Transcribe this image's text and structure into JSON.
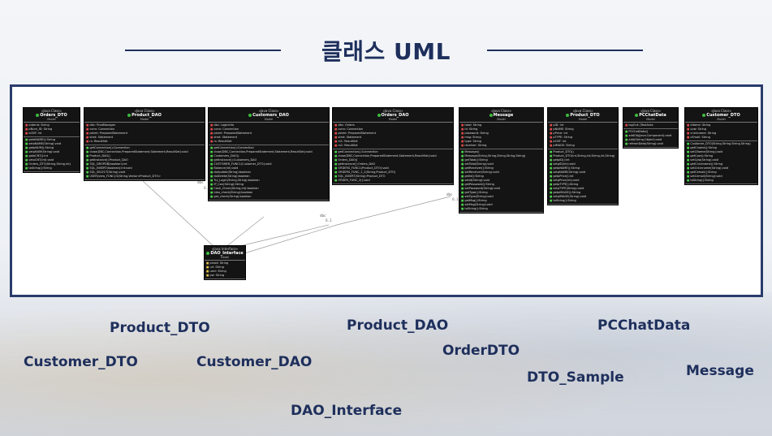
{
  "title": "클래스 UML",
  "diagram": {
    "classes": [
      {
        "id": "orders_dto",
        "stereotype": "«Java Class»",
        "name": "Orders_DTO",
        "package": "Model",
        "attrs": [
          {
            "m": "r",
            "t": "orderid: String"
          },
          {
            "m": "r",
            "t": "pNum_ID: String"
          },
          {
            "m": "r",
            "t": "oCNT: int"
          }
        ],
        "ops": [
          {
            "m": "g",
            "t": "getoNAME():String"
          },
          {
            "m": "g",
            "t": "setoNAME(String):void"
          },
          {
            "m": "g",
            "t": "getpNUM():String"
          },
          {
            "m": "g",
            "t": "setpNUM(String):void"
          },
          {
            "m": "g",
            "t": "getoCNT():int"
          },
          {
            "m": "g",
            "t": "setoCNT(int):void"
          },
          {
            "m": "g",
            "t": "Orders_DTO(String,String,int)"
          },
          {
            "m": "g",
            "t": "toString():String"
          }
        ]
      },
      {
        "id": "product_dao",
        "stereotype": "«Java Class»",
        "name": "Product_DAO",
        "package": "Model",
        "attrs": [
          {
            "m": "r",
            "t": "dbc: ProdManager"
          },
          {
            "m": "r",
            "t": "conn: Connection"
          },
          {
            "m": "r",
            "t": "pstmt: PreparedStatement"
          },
          {
            "m": "r",
            "t": "stmt: Statement"
          },
          {
            "m": "r",
            "t": "rs: ResultSet"
          }
        ],
        "ops": [
          {
            "m": "g",
            "t": "getConnection():Connection"
          },
          {
            "m": "g",
            "t": "close(DBC,Connection,PreparedStatement,Statement,ResultSet):void"
          },
          {
            "m": "g",
            "t": "Product_DAO()"
          },
          {
            "m": "g",
            "t": "getInstance():Product_DAO"
          },
          {
            "m": "g",
            "t": "SQL_DROPDB(boolean):int"
          },
          {
            "m": "g",
            "t": "SQL_INSERT(boolean):int:void"
          },
          {
            "m": "g",
            "t": "SQL_SELECT(String):void"
          },
          {
            "m": "g",
            "t": "USER(view_FUNC):S(String,Vector<Product_DTO>"
          }
        ]
      },
      {
        "id": "customer_dao",
        "stereotype": "«Java Class»",
        "name": "Customers_DAO",
        "package": "Model",
        "attrs": [
          {
            "m": "r",
            "t": "dbc: LoginInfo"
          },
          {
            "m": "r",
            "t": "conn: Connection"
          },
          {
            "m": "r",
            "t": "pstmt: PreparedStatement"
          },
          {
            "m": "r",
            "t": "stmt: Statement"
          },
          {
            "m": "r",
            "t": "rs: ResultSet"
          }
        ],
        "ops": [
          {
            "m": "g",
            "t": "getConnection():Connection"
          },
          {
            "m": "g",
            "t": "close(DBC,Connection,PreparedStatement,Statement,ResultSet):void"
          },
          {
            "m": "g",
            "t": "Customers_DAO()"
          },
          {
            "m": "g",
            "t": "getInstance():Customers_DAO"
          },
          {
            "m": "g",
            "t": "CUSTOMER_FUNC1(Customer_DTO):void"
          },
          {
            "m": "g",
            "t": "Balance(int):void"
          },
          {
            "m": "g",
            "t": "doUpdate(String):boolean"
          },
          {
            "m": "g",
            "t": "doDelete(String):boolean"
          },
          {
            "m": "g",
            "t": "Try_Login(String,String):boolean"
          },
          {
            "m": "g",
            "t": "IP_Con(String):String"
          },
          {
            "m": "g",
            "t": "Cash_Check(String,int):boolean"
          },
          {
            "m": "g",
            "t": "ideo_check(String):boolean"
          },
          {
            "m": "g",
            "t": "get_check(String):boolean"
          }
        ]
      },
      {
        "id": "orders_dao",
        "stereotype": "«Java Class»",
        "name": "Orders_DAO",
        "package": "Model",
        "attrs": [
          {
            "m": "r",
            "t": "dbc: Orders"
          },
          {
            "m": "r",
            "t": "conn: Connection"
          },
          {
            "m": "r",
            "t": "pstmt: PreparedStatement"
          },
          {
            "m": "r",
            "t": "stmt: Statement"
          },
          {
            "m": "r",
            "t": "rs1: ResultSet"
          },
          {
            "m": "r",
            "t": "rs2: ResultSet"
          }
        ],
        "ops": [
          {
            "m": "g",
            "t": "getConnection():Connection"
          },
          {
            "m": "g",
            "t": "close(DBC,Connection,PreparedStatement,Statement,ResultSet):void"
          },
          {
            "m": "g",
            "t": "Orders_DAO()"
          },
          {
            "m": "g",
            "t": "getInstance():Orders_DAO"
          },
          {
            "m": "g",
            "t": "ORDERS_FUNC1(Product_DTO):void"
          },
          {
            "m": "g",
            "t": "ORDERS_FUNC_1_2(String,Product_DTO)"
          },
          {
            "m": "g",
            "t": "SQL_INSERT(String):Product_DTO"
          },
          {
            "m": "g",
            "t": "ORDER_FUNC_2():void"
          }
        ]
      },
      {
        "id": "message",
        "stereotype": "«Java Class»",
        "name": "Message",
        "package": "Model",
        "attrs": [
          {
            "m": "r",
            "t": "total: String"
          },
          {
            "m": "r",
            "t": "id: String"
          },
          {
            "m": "r",
            "t": "password: String"
          },
          {
            "m": "r",
            "t": "msg: String"
          },
          {
            "m": "r",
            "t": "type: String"
          },
          {
            "m": "r",
            "t": "receiver: String"
          }
        ],
        "ops": [
          {
            "m": "g",
            "t": "Message()"
          },
          {
            "m": "g",
            "t": "Message(String,String,String,String,String)"
          },
          {
            "m": "g",
            "t": "getTotal():String"
          },
          {
            "m": "g",
            "t": "setTotal(String):void"
          },
          {
            "m": "g",
            "t": "getReceiver():String"
          },
          {
            "m": "g",
            "t": "setReceiver(String):void"
          },
          {
            "m": "g",
            "t": "getId():String"
          },
          {
            "m": "g",
            "t": "setId(String):void"
          },
          {
            "m": "g",
            "t": "getPassword():String"
          },
          {
            "m": "g",
            "t": "setPassword(String):void"
          },
          {
            "m": "g",
            "t": "getType():String"
          },
          {
            "m": "g",
            "t": "setType(String):void"
          },
          {
            "m": "g",
            "t": "getMsg():String"
          },
          {
            "m": "g",
            "t": "setMsg(String):void"
          },
          {
            "m": "g",
            "t": "toString():String"
          }
        ]
      },
      {
        "id": "product_dto",
        "stereotype": "«Java Class»",
        "name": "Product_DTO",
        "package": "Model",
        "attrs": [
          {
            "m": "r",
            "t": "pID: int"
          },
          {
            "m": "r",
            "t": "pNAME: String"
          },
          {
            "m": "r",
            "t": "pPrice: int"
          },
          {
            "m": "r",
            "t": "pTYPE: String"
          },
          {
            "m": "r",
            "t": "pCNT: int"
          },
          {
            "m": "r",
            "t": "pIMAGE: String"
          }
        ],
        "ops": [
          {
            "m": "g",
            "t": "Product_DTO()"
          },
          {
            "m": "g",
            "t": "Product_DTO(int,String,int,String,int,String)"
          },
          {
            "m": "g",
            "t": "getpID():int"
          },
          {
            "m": "g",
            "t": "setpID(int):void"
          },
          {
            "m": "g",
            "t": "getpNAME():String"
          },
          {
            "m": "g",
            "t": "setpNAME(String):void"
          },
          {
            "m": "g",
            "t": "getpPrice():int"
          },
          {
            "m": "g",
            "t": "setpPrice(int):void"
          },
          {
            "m": "g",
            "t": "getpTYPE():String"
          },
          {
            "m": "g",
            "t": "setpTYPE(String):void"
          },
          {
            "m": "g",
            "t": "getpIMAGE():String"
          },
          {
            "m": "g",
            "t": "setpIMAGE(String):void"
          },
          {
            "m": "g",
            "t": "toString():String"
          }
        ]
      },
      {
        "id": "pcchatdata",
        "stereotype": "«Java Class»",
        "name": "PCChatData",
        "package": "Model",
        "attrs": [
          {
            "m": "r",
            "t": "logOut: JTextArea"
          }
        ],
        "ops": [
          {
            "m": "g",
            "t": "PCChatData()"
          },
          {
            "m": "g",
            "t": "addObj(Java.Component):void"
          },
          {
            "m": "g",
            "t": "add(String,Object):void"
          },
          {
            "m": "g",
            "t": "refreshData(String):void"
          }
        ]
      },
      {
        "id": "customer_dto",
        "stereotype": "«Java Class»",
        "name": "Customer_DTO",
        "package": "Model",
        "attrs": [
          {
            "m": "r",
            "t": "cName: String"
          },
          {
            "m": "r",
            "t": "cpw: String"
          },
          {
            "m": "r",
            "t": "cnickname: String"
          },
          {
            "m": "r",
            "t": "cEmail: String"
          }
        ],
        "ops": [
          {
            "m": "g",
            "t": "Customer_DTO(String,String,String,String)"
          },
          {
            "m": "g",
            "t": "getCname():String"
          },
          {
            "m": "g",
            "t": "setCName(String):void"
          },
          {
            "m": "g",
            "t": "getCpw():String"
          },
          {
            "m": "g",
            "t": "setCpw(String):void"
          },
          {
            "m": "g",
            "t": "getCnickname():String"
          },
          {
            "m": "g",
            "t": "setCnickname(String):void"
          },
          {
            "m": "g",
            "t": "getCemail():String"
          },
          {
            "m": "g",
            "t": "setCemail(String):void"
          },
          {
            "m": "g",
            "t": "toString():String"
          }
        ]
      },
      {
        "id": "dao_interface",
        "stereotype": "«Java Interface»",
        "name": "DAO_Interface",
        "package": "Model",
        "attrs": [
          {
            "m": "y",
            "t": "pmod: String"
          },
          {
            "m": "y",
            "t": "url: String"
          },
          {
            "m": "y",
            "t": "user: String"
          },
          {
            "m": "y",
            "t": "pw: String"
          }
        ],
        "ops": []
      }
    ],
    "edge_labels": {
      "dbc": "dbc",
      "mult": "0..1"
    }
  },
  "labels": {
    "product_dto": "Product_DTO",
    "product_dao": "Product_DAO",
    "pcchatdata": "PCChatData",
    "orderdto": "OrderDTO",
    "customer_dto": "Customer_DTO",
    "customer_dao": "Customer_DAO",
    "dto_sample": "DTO_Sample",
    "message": "Message",
    "dao_interface": "DAO_Interface"
  }
}
